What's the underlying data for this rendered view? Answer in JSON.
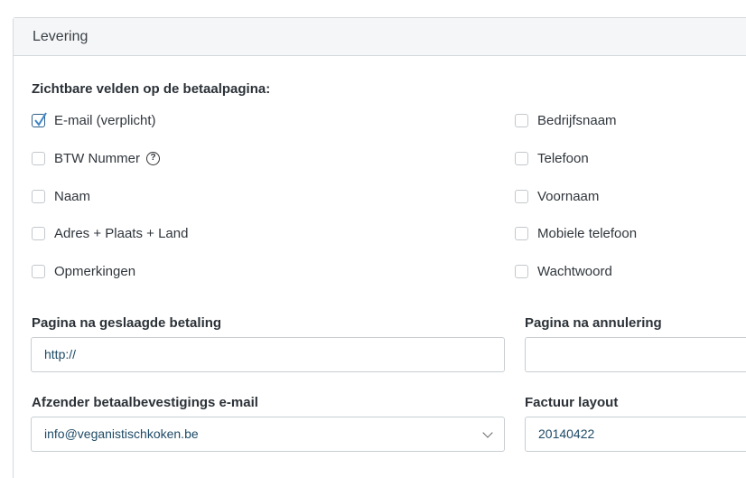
{
  "section": {
    "title": "Levering"
  },
  "visible_fields": {
    "title": "Zichtbare velden op de betaalpagina:",
    "left": [
      {
        "label": "E-mail (verplicht)",
        "checked": true
      },
      {
        "label": "BTW Nummer",
        "checked": false,
        "help": "?"
      },
      {
        "label": "Naam",
        "checked": false
      },
      {
        "label": "Adres + Plaats + Land",
        "checked": false
      },
      {
        "label": "Opmerkingen",
        "checked": false
      }
    ],
    "right": [
      {
        "label": "Bedrijfsnaam",
        "checked": false
      },
      {
        "label": "Telefoon",
        "checked": false
      },
      {
        "label": "Voornaam",
        "checked": false
      },
      {
        "label": "Mobiele telefoon",
        "checked": false
      },
      {
        "label": "Wachtwoord",
        "checked": false
      }
    ]
  },
  "success_page": {
    "label": "Pagina na geslaagde betaling",
    "value": "http://"
  },
  "cancel_page": {
    "label": "Pagina na annulering",
    "value": ""
  },
  "sender": {
    "label": "Afzender betaalbevestigings e-mail",
    "value": "info@veganistischkoken.be"
  },
  "invoice": {
    "label": "Factuur layout",
    "value": "20140422"
  }
}
